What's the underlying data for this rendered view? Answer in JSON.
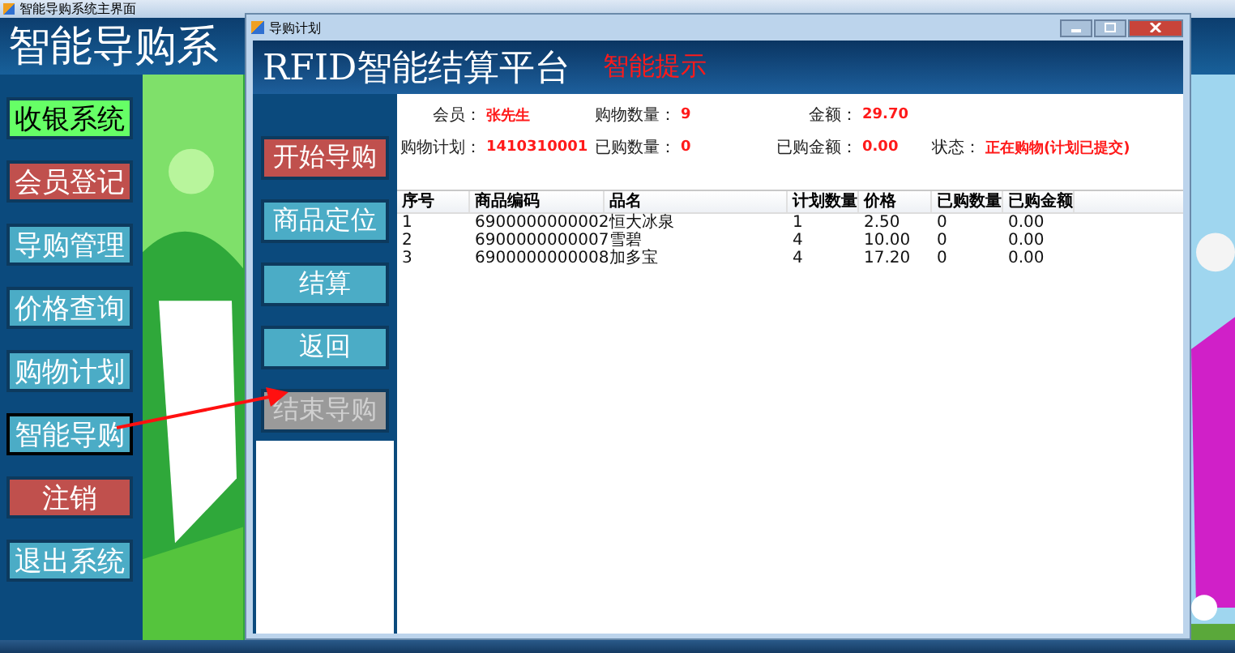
{
  "main_window": {
    "title": "智能导购系统主界面",
    "heading": "智能导购系",
    "menu": [
      {
        "label": "收银系统",
        "color": "#66ff66",
        "selected": false
      },
      {
        "label": "会员登记",
        "color": "#c0504d",
        "selected": false
      },
      {
        "label": "导购管理",
        "color": "#4bacc6",
        "selected": false
      },
      {
        "label": "价格查询",
        "color": "#4bacc6",
        "selected": false
      },
      {
        "label": "购物计划",
        "color": "#4bacc6",
        "selected": false
      },
      {
        "label": "智能导购",
        "color": "#4bacc6",
        "selected": true
      },
      {
        "label": "注销",
        "color": "#c0504d",
        "selected": false
      },
      {
        "label": "退出系统",
        "color": "#4bacc6",
        "selected": false
      }
    ]
  },
  "dialog": {
    "title": "导购计划",
    "heading": "RFID智能结算平台",
    "hint": "智能提示",
    "buttons": [
      {
        "label": "开始导购",
        "color": "#c0504d",
        "disabled": false
      },
      {
        "label": "商品定位",
        "color": "#4bacc6",
        "disabled": false
      },
      {
        "label": "结算",
        "color": "#4bacc6",
        "disabled": false
      },
      {
        "label": "返回",
        "color": "#4bacc6",
        "disabled": false
      },
      {
        "label": "结束导购",
        "disabled": true
      }
    ],
    "info": [
      [
        {
          "label": "会员：",
          "value": "张先生"
        },
        {
          "label": "购物数量：",
          "value": "9"
        },
        {
          "label": "金额：",
          "value": "29.70"
        }
      ],
      [
        {
          "label": "购物计划：",
          "value": "1410310001"
        },
        {
          "label": "已购数量：",
          "value": "0"
        },
        {
          "label": "已购金额：",
          "value": "0.00"
        },
        {
          "label": "状态：",
          "value": "正在购物(计划已提交)"
        }
      ]
    ],
    "table": {
      "columns": [
        "序号",
        "商品编码",
        "品名",
        "计划数量",
        "价格",
        "已购数量",
        "已购金额"
      ],
      "rows": [
        [
          "1",
          "6900000000002",
          "恒大冰泉",
          "1",
          "2.50",
          "0",
          "0.00"
        ],
        [
          "2",
          "6900000000007",
          "雪碧",
          "4",
          "10.00",
          "0",
          "0.00"
        ],
        [
          "3",
          "6900000000008",
          "加多宝",
          "4",
          "17.20",
          "0",
          "0.00"
        ]
      ]
    }
  }
}
